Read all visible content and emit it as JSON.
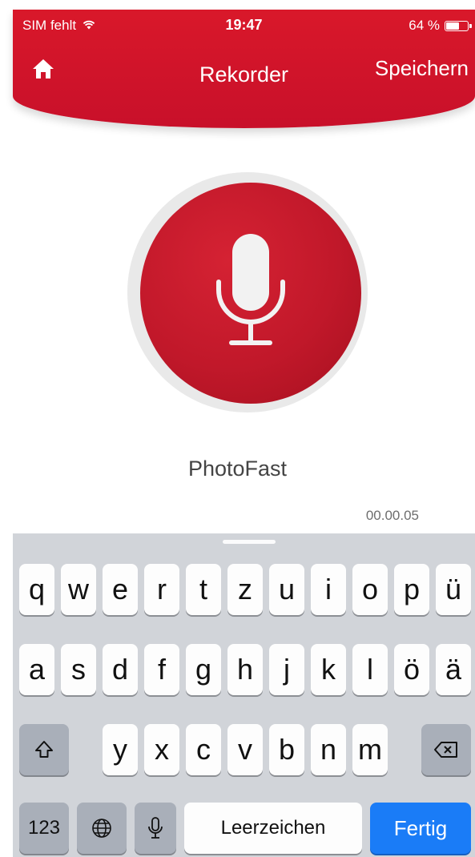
{
  "status_bar": {
    "carrier": "SIM fehlt",
    "time": "19:47",
    "battery": "64 %",
    "battery_level": 0.64
  },
  "header": {
    "title": "Rekorder",
    "save_label": "Speichern"
  },
  "recorder": {
    "name": "PhotoFast",
    "elapsed": "00.00.05"
  },
  "keyboard": {
    "row1": [
      "q",
      "w",
      "e",
      "r",
      "t",
      "z",
      "u",
      "i",
      "o",
      "p",
      "ü"
    ],
    "row2": [
      "a",
      "s",
      "d",
      "f",
      "g",
      "h",
      "j",
      "k",
      "l",
      "ö",
      "ä"
    ],
    "row3": [
      "y",
      "x",
      "c",
      "v",
      "b",
      "n",
      "m"
    ],
    "numbers_label": "123",
    "space_label": "Leerzeichen",
    "done_label": "Fertig"
  },
  "colors": {
    "brand_red": "#c8102a",
    "keyboard_bg": "#d1d4d9",
    "done_blue": "#1a7cf7"
  },
  "icons": [
    "home-icon",
    "wifi-icon",
    "battery-icon",
    "microphone-icon",
    "shift-icon",
    "backspace-icon",
    "globe-icon",
    "dictation-icon"
  ]
}
